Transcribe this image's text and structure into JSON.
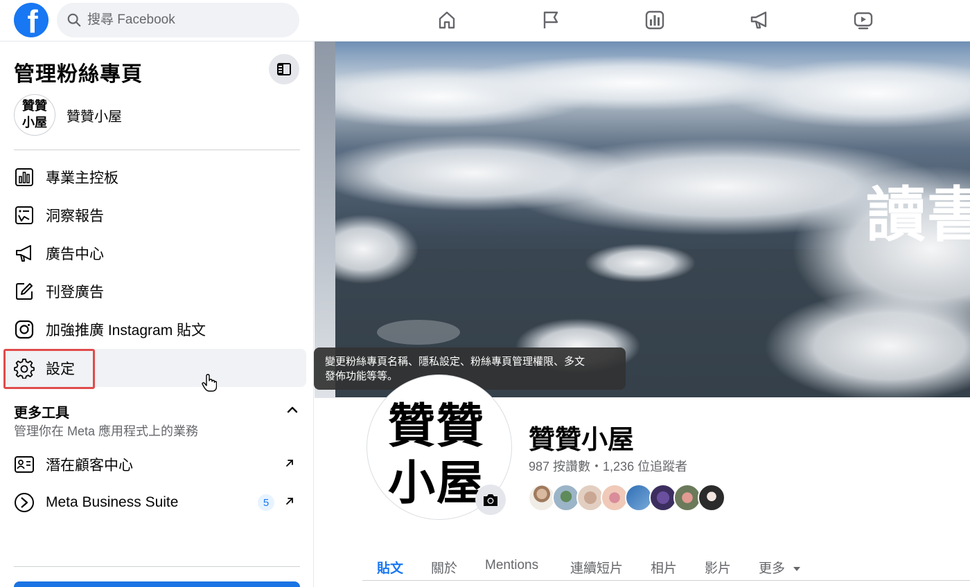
{
  "topbar": {
    "logo": "f",
    "search_placeholder": "搜尋 Facebook",
    "nav_icons": [
      "home-icon",
      "pages-flag-icon",
      "insights-icon",
      "ads-megaphone-icon",
      "video-icon"
    ]
  },
  "sidebar": {
    "title": "管理粉絲專頁",
    "page": {
      "avatar_line1": "贊贊",
      "avatar_line2": "小屋",
      "name": "贊贊小屋"
    },
    "items": [
      {
        "label": "專業主控板",
        "icon": "dashboard-icon"
      },
      {
        "label": "洞察報告",
        "icon": "insights-report-icon"
      },
      {
        "label": "廣告中心",
        "icon": "megaphone-icon"
      },
      {
        "label": "刊登廣告",
        "icon": "edit-icon"
      },
      {
        "label": "加強推廣 Instagram 貼文",
        "icon": "instagram-icon"
      },
      {
        "label": "設定",
        "icon": "gear-icon"
      }
    ],
    "more_tools": {
      "title": "更多工具",
      "subtitle": "管理你在 Meta 應用程式上的業務",
      "items": [
        {
          "label": "潛在顧客中心",
          "icon": "contact-card-icon"
        },
        {
          "label": "Meta Business Suite",
          "icon": "business-suite-icon",
          "badge": "5"
        }
      ]
    }
  },
  "tooltip": {
    "line1": "變更粉絲專頁名稱、隱私設定、粉絲專頁管理權限、多文",
    "line2": "發佈功能等等。"
  },
  "cover": {
    "text": "讀書"
  },
  "profile": {
    "pic_line1": "贊贊",
    "pic_line2": "小屋",
    "name": "贊贊小屋",
    "stats": "987 按讚數・1,236 位追蹤者"
  },
  "tabs": [
    "貼文",
    "關於",
    "Mentions",
    "連續短片",
    "相片",
    "影片",
    "更多"
  ],
  "colors": {
    "brand": "#1877f2",
    "highlight": "#e04b4b"
  }
}
